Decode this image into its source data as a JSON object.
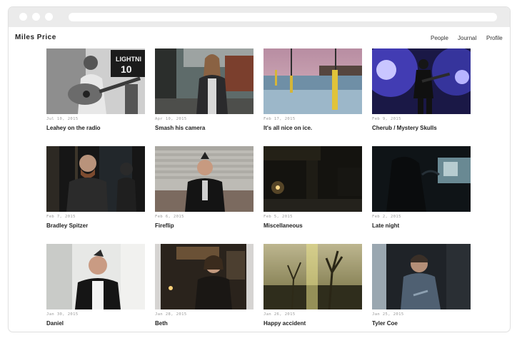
{
  "site": {
    "title": "Miles Price",
    "nav": [
      "People",
      "Journal",
      "Profile"
    ]
  },
  "posts": [
    {
      "date": "Jul 10, 2015",
      "title": "Leahey on the radio"
    },
    {
      "date": "Apr 10, 2015",
      "title": "Smash his camera"
    },
    {
      "date": "Feb 17, 2015",
      "title": "It's all nice on ice."
    },
    {
      "date": "Feb 9, 2015",
      "title": "Cherub / Mystery Skulls"
    },
    {
      "date": "Feb 7, 2015",
      "title": "Bradley Spitzer"
    },
    {
      "date": "Feb 6, 2015",
      "title": "Fireflip"
    },
    {
      "date": "Feb 5, 2015",
      "title": "Miscellaneous"
    },
    {
      "date": "Feb 2, 2015",
      "title": "Late night"
    },
    {
      "date": "Jan 30, 2015",
      "title": "Daniel"
    },
    {
      "date": "Jan 28, 2015",
      "title": "Beth"
    },
    {
      "date": "Jan 26, 2015",
      "title": "Happy accident"
    },
    {
      "date": "Jan 25, 2015",
      "title": "Tyler Coe"
    }
  ]
}
